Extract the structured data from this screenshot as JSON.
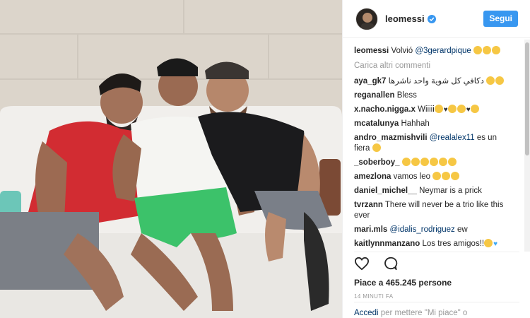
{
  "post": {
    "username": "leomessi",
    "follow_label": "Segui",
    "caption": {
      "user": "leomessi",
      "text": "Volvió",
      "mention": "@3gerardpique"
    },
    "load_more": "Carica altri commenti",
    "comments": [
      {
        "user": "aya_gk7",
        "text": "دكافي كل شوية واحد ناشرها",
        "emoji_count": 2
      },
      {
        "user": "reganallen",
        "text": "Bless"
      },
      {
        "user": "x.nacho.nigga.x",
        "text": "Wiiiii",
        "emoji_pattern": "emoji-heart-emoji-emoji-heart-emoji"
      },
      {
        "user": "mcatalunya",
        "text": "Hahhah"
      },
      {
        "user": "andro_mazmishvili",
        "mention": "@realalex11",
        "text": "es un fiera",
        "emoji_count": 1
      },
      {
        "user": "_soberboy_",
        "text": "",
        "emoji_count": 6
      },
      {
        "user": "amezlona",
        "text": "vamos leo",
        "emoji_count": 3
      },
      {
        "user": "daniel_michel__",
        "text": "Neymar is a prick"
      },
      {
        "user": "tvrzann",
        "text": "There will never be a trio like this ever"
      },
      {
        "user": "mari.mls",
        "mention": "@idalis_rodriguez",
        "text": "ew"
      },
      {
        "user": "kaitlynnmanzano",
        "text": "Los tres amigos!!",
        "emoji_pattern": "emoji-blueheart"
      }
    ],
    "likes_text": "Piace a 465.245 persone",
    "time_text": "14 MINUTI FA",
    "login_prompt": "Accedi",
    "login_rest": "per mettere \"Mi piace\" o"
  },
  "icons": {
    "like": "heart-outline-icon",
    "comment": "comment-bubble-icon",
    "verified": "verified-badge-icon"
  },
  "colors": {
    "accent": "#3897f0",
    "link": "#003569",
    "muted": "#999999"
  }
}
